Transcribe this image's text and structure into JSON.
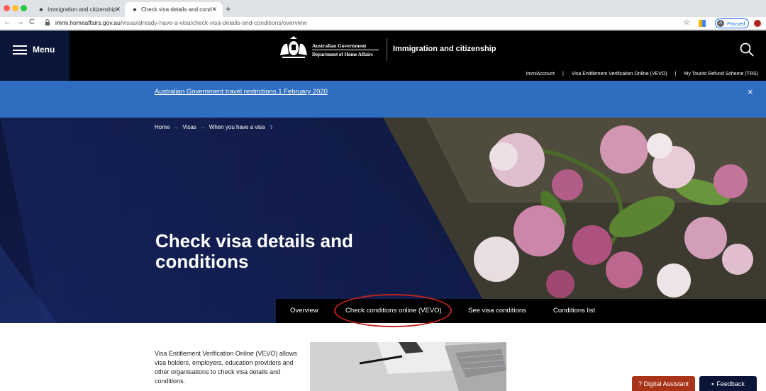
{
  "browser": {
    "tabs": [
      {
        "title": "Immigration and citizenship",
        "active": false
      },
      {
        "title": "Check visa details and conditions",
        "active": true
      }
    ],
    "url_host": "immi.homeaffairs.gov.au",
    "url_path": "/visas/already-have-a-visa/check-visa-details-and-conditions/overview",
    "profile_initial": "A",
    "profile_status": "Paused"
  },
  "header": {
    "menu_label": "Menu",
    "gov_line1": "Australian Government",
    "gov_line2": "Department of Home Affairs",
    "site_name": "Immigration and citizenship"
  },
  "utility_links": [
    "ImmiAccount",
    "Visa Entitlement Verification Online (VEVO)",
    "My Tourist Refund Scheme (TRS)"
  ],
  "alert": {
    "text": "Australian Government travel restrictions 1 February 2020",
    "close": "×"
  },
  "breadcrumb": [
    "Home",
    "Visas",
    "When you have a visa"
  ],
  "hero": {
    "title": "Check visa details and conditions"
  },
  "page_tabs": [
    "Overview",
    "Check conditions online (VEVO)",
    "See visa conditions",
    "Conditions list"
  ],
  "intro_text": "Visa Entitlement Verification Online (VEVO) allows visa holders, employers, education providers and other organisations to check visa details and conditions.",
  "floating": {
    "assistant": "? Digital Assistant",
    "feedback": "Feedback"
  },
  "colors": {
    "alert_bg": "#2e6dbf",
    "hero_bg": "#0f1a45",
    "highlight": "#c0261c"
  }
}
